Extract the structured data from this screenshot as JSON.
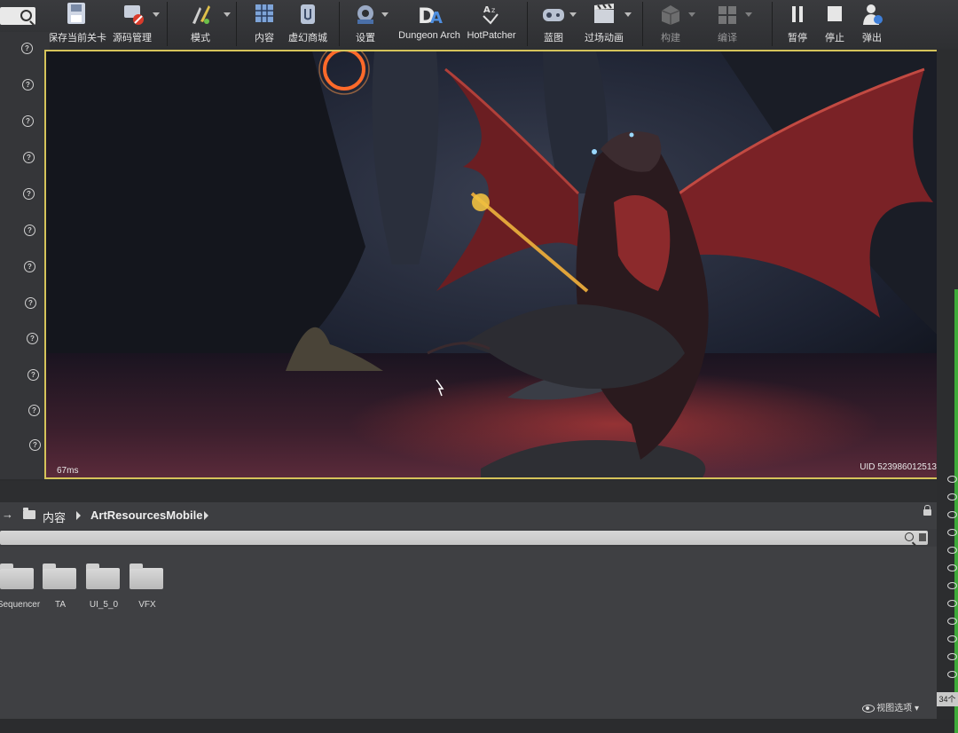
{
  "toolbar": {
    "buttons": [
      {
        "label": "保存当前关卡",
        "icon": "save-icon"
      },
      {
        "label": "源码管理",
        "icon": "source-control-icon"
      },
      {
        "label": "模式",
        "icon": "modes-icon"
      },
      {
        "label": "内容",
        "icon": "content-icon"
      },
      {
        "label": "虚幻商城",
        "icon": "marketplace-icon"
      },
      {
        "label": "设置",
        "icon": "settings-icon"
      },
      {
        "label": "Dungeon Arch",
        "icon": "dungeon-arch-icon"
      },
      {
        "label": "HotPatcher",
        "icon": "hotpatcher-icon"
      },
      {
        "label": "蓝图",
        "icon": "blueprint-icon"
      },
      {
        "label": "过场动画",
        "icon": "cinematics-icon"
      },
      {
        "label": "构建",
        "icon": "build-icon"
      },
      {
        "label": "编译",
        "icon": "compile-icon"
      },
      {
        "label": "暂停",
        "icon": "pause-icon"
      },
      {
        "label": "停止",
        "icon": "stop-icon"
      },
      {
        "label": "弹出",
        "icon": "eject-icon"
      }
    ]
  },
  "viewport": {
    "frame_time": "67ms",
    "uid": "UID 523986012513"
  },
  "content_browser": {
    "breadcrumb": [
      "内容",
      "ArtResourcesMobile"
    ],
    "folders": [
      "Sequencer",
      "TA",
      "UI_5_0",
      "VFX"
    ],
    "view_options_label": "视图选项",
    "item_count": "34个"
  },
  "colors": {
    "viewport_border": "#d5c35a",
    "accent_green": "#3faa3a"
  }
}
